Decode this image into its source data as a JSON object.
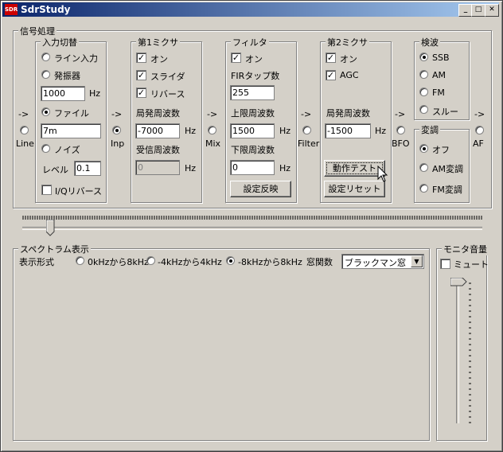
{
  "window": {
    "title": "SdrStudy",
    "icon_text": "SDR",
    "minimize": "_",
    "maximize": "□",
    "close": "✕"
  },
  "signal": {
    "title": "信号処理"
  },
  "input": {
    "title": "入力切替",
    "line_in": "ライン入力",
    "oscillator": "発振器",
    "osc_freq": "1000",
    "hz": "Hz",
    "file": "ファイル",
    "file_name": "7m",
    "noise": "ノイズ",
    "level_label": "レベル",
    "level_value": "0.1",
    "iq_reverse": "I/Qリバース"
  },
  "mixer1": {
    "title": "第1ミクサ",
    "on": "オン",
    "slider": "スライダ",
    "reverse": "リバース",
    "lo_label": "局発周波数",
    "lo_value": "-7000",
    "rx_label": "受信周波数",
    "rx_value": "0",
    "hz": "Hz"
  },
  "filter": {
    "title": "フィルタ",
    "on": "オン",
    "fir_label": "FIRタップ数",
    "fir_value": "255",
    "upper_label": "上限周波数",
    "upper_value": "1500",
    "lower_label": "下限周波数",
    "lower_value": "0",
    "apply_button": "設定反映",
    "hz": "Hz"
  },
  "mixer2": {
    "title": "第2ミクサ",
    "on": "オン",
    "agc": "AGC",
    "lo_label": "局発周波数",
    "lo_value": "-1500",
    "test_button": "動作テスト",
    "reset_button": "設定リセット",
    "hz": "Hz"
  },
  "detector": {
    "title": "検波",
    "ssb": "SSB",
    "am": "AM",
    "fm": "FM",
    "through": "スルー"
  },
  "modulation": {
    "title": "変調",
    "off": "オフ",
    "am": "AM変調",
    "fm": "FM変調"
  },
  "taps": {
    "arrow": "->",
    "line": "Line",
    "inp": "Inp",
    "mix": "Mix",
    "filter": "Filter",
    "bfo": "BFO",
    "af": "AF"
  },
  "spectrum": {
    "title": "スペクトラム表示",
    "format_label": "表示形式",
    "range1": "0kHzから8kHz",
    "range2": "-4kHzから4kHz",
    "range3": "-8kHzから8kHz",
    "window_label": "窓関数",
    "window_value": "ブラックマン窓"
  },
  "monitor": {
    "title": "モニタ音量",
    "mute": "ミュート"
  }
}
